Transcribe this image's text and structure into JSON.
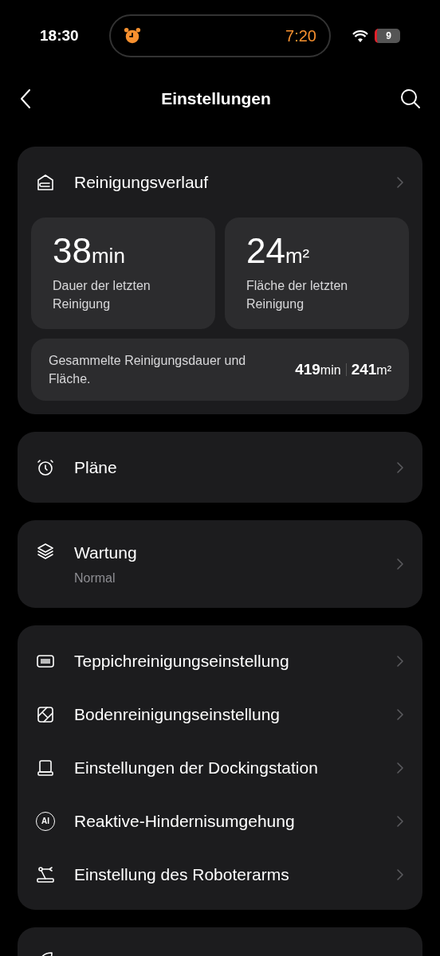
{
  "status_bar": {
    "time": "18:30",
    "alarm_time": "7:20",
    "battery": "9"
  },
  "nav": {
    "title": "Einstellungen"
  },
  "history": {
    "title": "Reinigungsverlauf",
    "stats": [
      {
        "value": "38",
        "unit": "min",
        "label": "Dauer der letzten Reinigung"
      },
      {
        "value": "24",
        "unit": "m²",
        "label": "Fläche der letzten Reinigung"
      }
    ],
    "total": {
      "label": "Gesammelte Reinigungsdauer und Fläche.",
      "minutes": "419",
      "minutes_unit": "min",
      "area": "241",
      "area_unit": "m²"
    }
  },
  "groups": [
    [
      {
        "label": "Pläne"
      }
    ],
    [
      {
        "label": "Wartung",
        "subtitle": "Normal"
      }
    ],
    [
      {
        "label": "Teppichreinigungseinstellung"
      },
      {
        "label": "Bodenreinigungseinstellung"
      },
      {
        "label": "Einstellungen der Dockingstation"
      },
      {
        "label": "Reaktive-Hindernisumgehung",
        "icon_text": "AI"
      },
      {
        "label": "Einstellung des Roboterarms"
      }
    ]
  ]
}
